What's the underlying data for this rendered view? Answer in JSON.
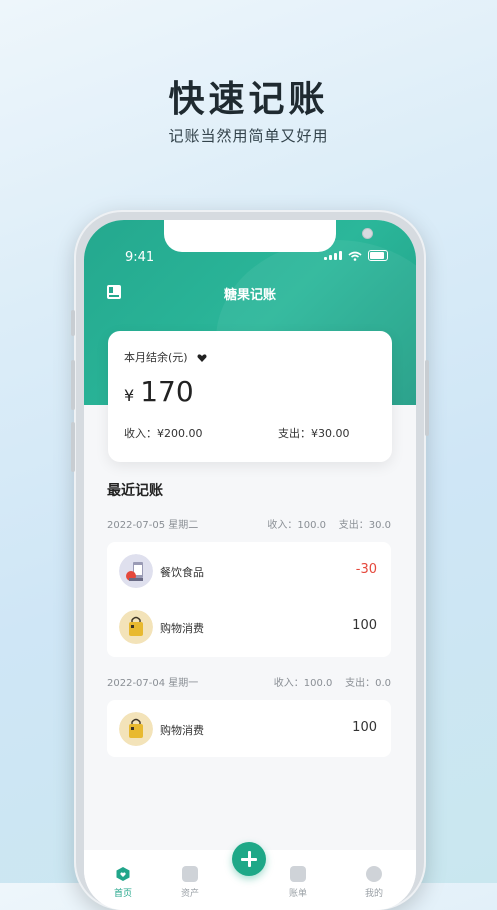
{
  "promo": {
    "title": "快速记账",
    "subtitle": "记账当然用简单又好用"
  },
  "status_bar": {
    "time": "9:41"
  },
  "header": {
    "title": "糖果记账"
  },
  "summary": {
    "label": "本月结余(元)",
    "currency": "¥",
    "balance": "170",
    "income": "收入：¥200.00",
    "expense": "支出：¥30.00"
  },
  "recent": {
    "title": "最近记账",
    "days": [
      {
        "date": "2022-07-05 星期二",
        "totals": "收入：100.0    支出：30.0",
        "entries": [
          {
            "icon": "food-icon",
            "name": "餐饮食品",
            "amount": "-30"
          },
          {
            "icon": "shopping-bag-icon",
            "name": "购物消费",
            "amount": "100"
          }
        ]
      },
      {
        "date": "2022-07-04 星期一",
        "totals": "收入：100.0    支出：0.0",
        "entries": [
          {
            "icon": "shopping-bag-icon",
            "name": "购物消费",
            "amount": "100"
          }
        ]
      }
    ]
  },
  "tabs": {
    "home": "首页",
    "assets": "资产",
    "bills": "账单",
    "mine": "我的"
  },
  "colors": {
    "accent": "#21a58a",
    "negative": "#e5483c"
  }
}
